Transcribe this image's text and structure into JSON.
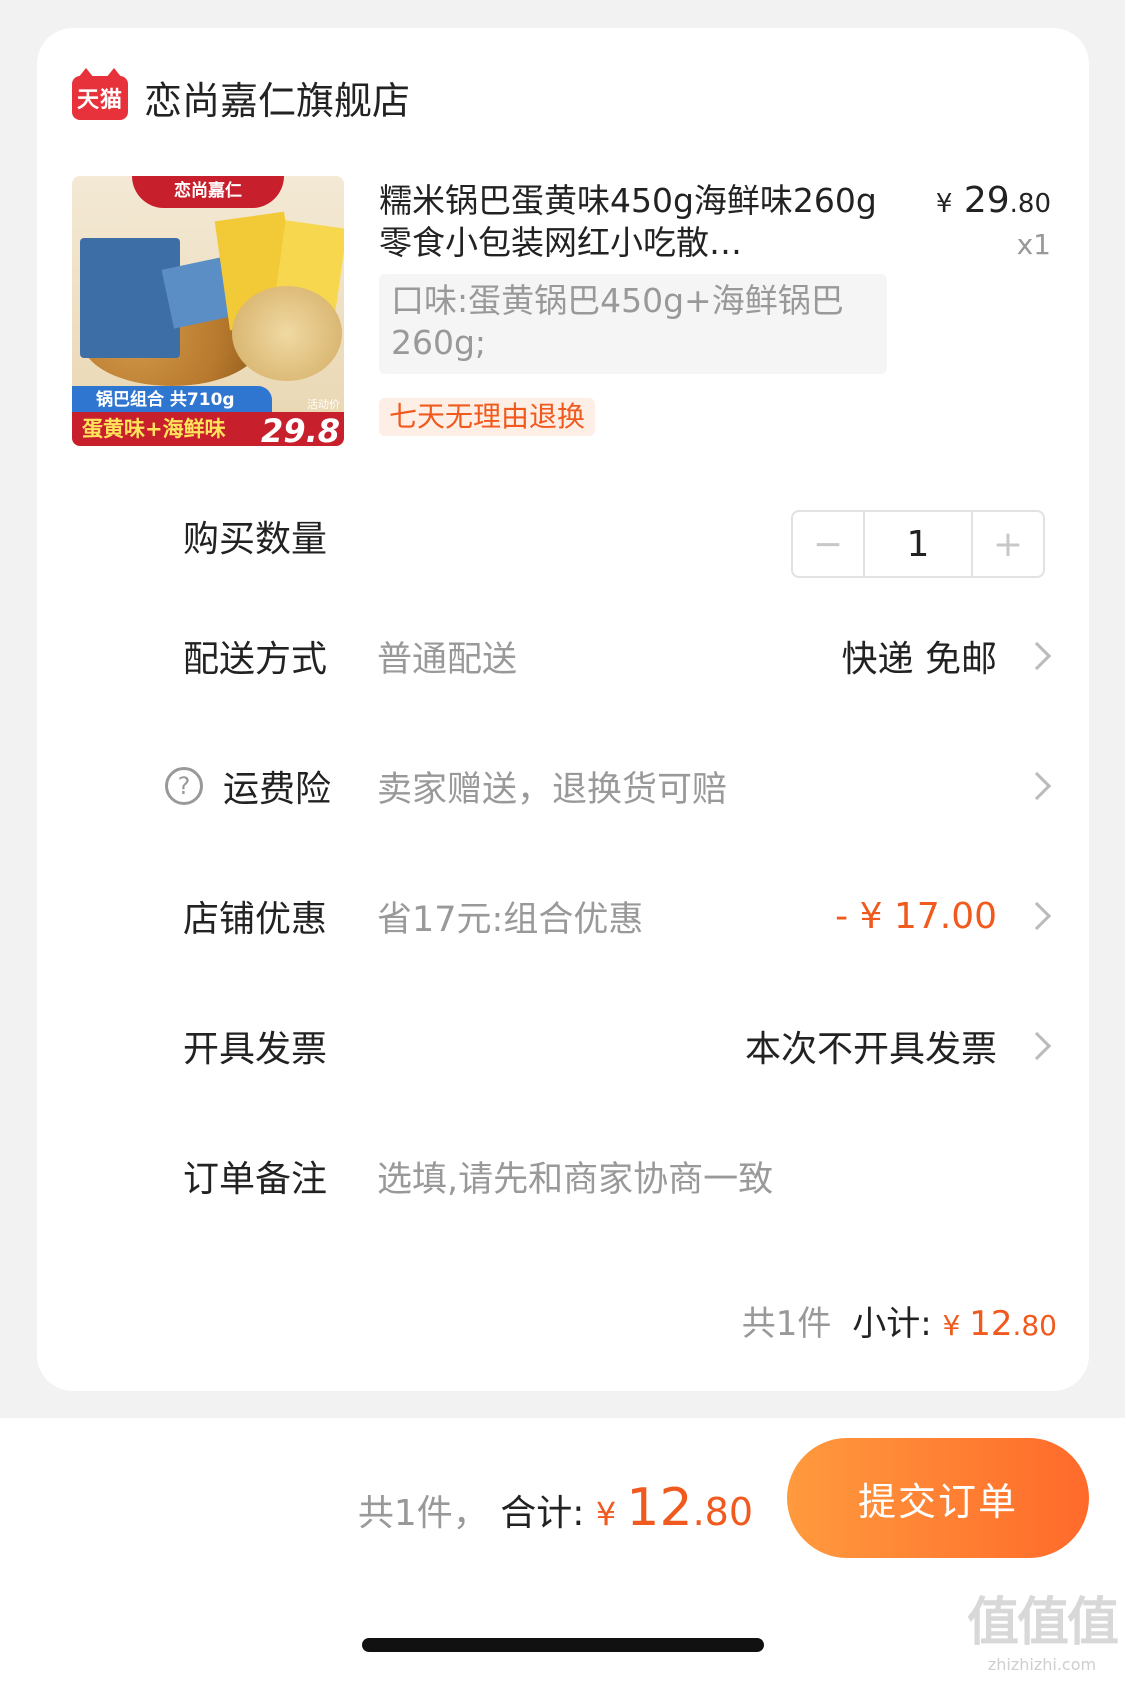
{
  "store": {
    "badge": "天猫",
    "name": "恋尚嘉仁旗舰店"
  },
  "product": {
    "image": {
      "brand": "恋尚嘉仁",
      "combo": "锅巴组合 共710g",
      "flavors": "蛋黄味+海鲜味",
      "activity_label": "活动价",
      "activity_price": "29.8"
    },
    "title": "糯米锅巴蛋黄味450g海鲜味260g零食小包装网红小吃散…",
    "price_symbol": "¥",
    "price_int": "29",
    "price_dec": ".80",
    "quantity_label": "x1",
    "flavor": "口味:蛋黄锅巴450g+海鲜锅巴260g;",
    "return_tag": "七天无理由退换"
  },
  "quantity": {
    "label": "购买数量",
    "value": "1",
    "minus": "−",
    "plus": "+"
  },
  "delivery": {
    "label": "配送方式",
    "sub": "普通配送",
    "value": "快递 免邮"
  },
  "insurance": {
    "icon": "?",
    "label": "运费险",
    "sub": "卖家赠送，退换货可赔"
  },
  "discount": {
    "label": "店铺优惠",
    "sub": "省17元:组合优惠",
    "value": "- ¥ 17.00"
  },
  "invoice": {
    "label": "开具发票",
    "value": "本次不开具发票"
  },
  "note": {
    "label": "订单备注",
    "placeholder": "选填,请先和商家协商一致"
  },
  "subtotal": {
    "count": "共1件",
    "label": "小计:",
    "yen": "¥ ",
    "int": "12",
    "dec": ".80"
  },
  "footer": {
    "count": "共1件，",
    "label": "合计:",
    "yen": "¥ ",
    "int": "12",
    "dec": ".80",
    "submit": "提交订单"
  },
  "watermark": {
    "big": "值值值",
    "small": "zhizhizhi.com"
  },
  "colors": {
    "accent": "#f05a1e",
    "submit_gradient_start": "#ff9a3e",
    "submit_gradient_end": "#ff6a2a",
    "tmall_red": "#e8323b"
  }
}
